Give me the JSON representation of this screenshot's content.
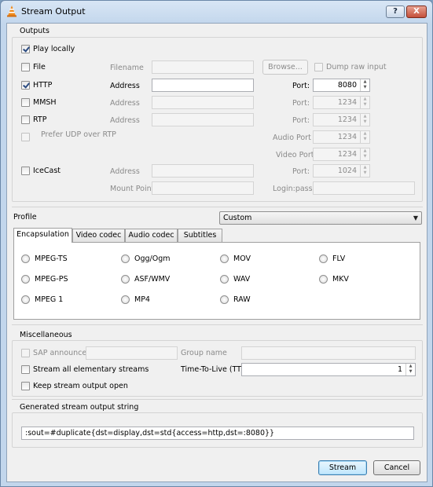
{
  "window": {
    "title": "Stream Output",
    "help_label": "?",
    "close_label": "X"
  },
  "outputs": {
    "title": "Outputs",
    "play_locally": {
      "label": "Play locally",
      "checked": true
    },
    "file": {
      "label": "File",
      "filename_label": "Filename",
      "filename_value": "",
      "browse_label": "Browse...",
      "dump_raw_label": "Dump raw input"
    },
    "http": {
      "label": "HTTP",
      "checked": true,
      "address_label": "Address",
      "address_value": "",
      "port_label": "Port:",
      "port_value": "8080"
    },
    "mmsh": {
      "label": "MMSH",
      "address_label": "Address",
      "address_value": "",
      "port_label": "Port:",
      "port_value": "1234"
    },
    "rtp": {
      "label": "RTP",
      "address_label": "Address",
      "address_value": "",
      "port_label": "Port:",
      "port_value": "1234",
      "prefer_udp_label": "Prefer UDP over RTP",
      "audio_port_label": "Audio Port",
      "audio_port_value": "1234",
      "video_port_label": "Video Port",
      "video_port_value": "1234"
    },
    "icecast": {
      "label": "IceCast",
      "address_label": "Address",
      "address_value": "",
      "port_label": "Port:",
      "port_value": "1024",
      "mount_point_label": "Mount Point",
      "mount_point_value": "",
      "login_pass_label": "Login:pass",
      "login_pass_value": ""
    }
  },
  "profile": {
    "label": "Profile",
    "selected": "Custom",
    "tabs": [
      "Encapsulation",
      "Video codec",
      "Audio codec",
      "Subtitles"
    ],
    "active_tab": "Encapsulation",
    "encapsulation_options": [
      "MPEG-TS",
      "Ogg/Ogm",
      "MOV",
      "FLV",
      "MPEG-PS",
      "ASF/WMV",
      "WAV",
      "MKV",
      "MPEG 1",
      "MP4",
      "RAW"
    ]
  },
  "misc": {
    "title": "Miscellaneous",
    "sap_label": "SAP announce",
    "sap_value": "",
    "group_name_label": "Group name",
    "group_name_value": "",
    "stream_all_label": "Stream all elementary streams",
    "ttl_label": "Time-To-Live (TTL)",
    "ttl_value": "1",
    "keep_open_label": "Keep stream output open"
  },
  "generated": {
    "title": "Generated stream output string",
    "value": ":sout=#duplicate{dst=display,dst=std{access=http,dst=:8080}}"
  },
  "buttons": {
    "stream_label": "Stream",
    "cancel_label": "Cancel"
  },
  "colors": {
    "accent": "#3c7fb1",
    "title_bar": "#c2d6ec"
  }
}
